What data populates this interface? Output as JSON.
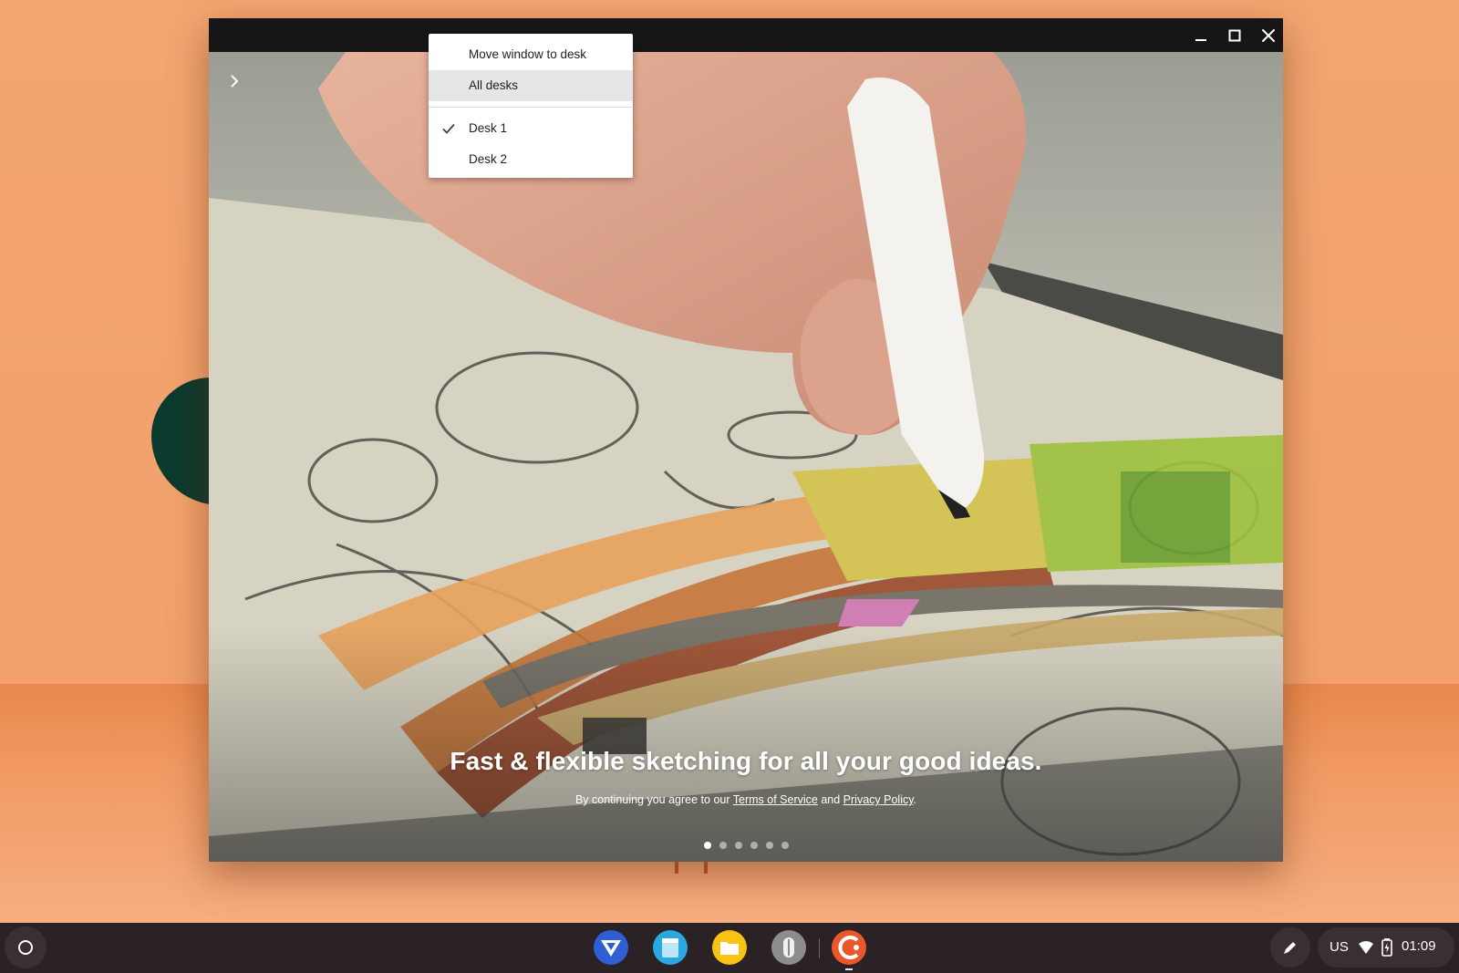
{
  "window": {
    "controls": {
      "minimize_icon": "minimize-icon",
      "maximize_icon": "maximize-icon",
      "close_icon": "close-icon"
    }
  },
  "context_menu": {
    "title_item": "Move window to desk",
    "items": [
      {
        "label": "All desks",
        "highlighted": true,
        "checked": false
      },
      {
        "label": "Desk 1",
        "highlighted": false,
        "checked": true
      },
      {
        "label": "Desk 2",
        "highlighted": false,
        "checked": false
      }
    ]
  },
  "onboarding": {
    "headline": "Fast & flexible sketching for all your good ideas.",
    "legal_prefix": "By continuing you agree to our ",
    "terms_link": "Terms of Service",
    "legal_and": " and ",
    "privacy_link": "Privacy Policy",
    "legal_suffix": ".",
    "page_count": 6,
    "active_page": 1
  },
  "shelf": {
    "launcher_icon": "launcher-icon",
    "apps": [
      {
        "name": "vectr-app-icon",
        "color": "#2f5fd3"
      },
      {
        "name": "notes-app-icon",
        "color": "#2aa8e0"
      },
      {
        "name": "files-app-icon",
        "color": "#f8c313"
      },
      {
        "name": "stylus-app-icon",
        "color": "#8c8c8c"
      },
      {
        "name": "concepts-app-icon",
        "color": "#e8582a"
      }
    ],
    "tray": {
      "ime": "US",
      "time": "01:09"
    }
  },
  "colors": {
    "wallpaper": "#f3a670",
    "shelf": "#2b2226",
    "titlebar": "#161616",
    "menu_highlight": "#e6e6e6"
  }
}
